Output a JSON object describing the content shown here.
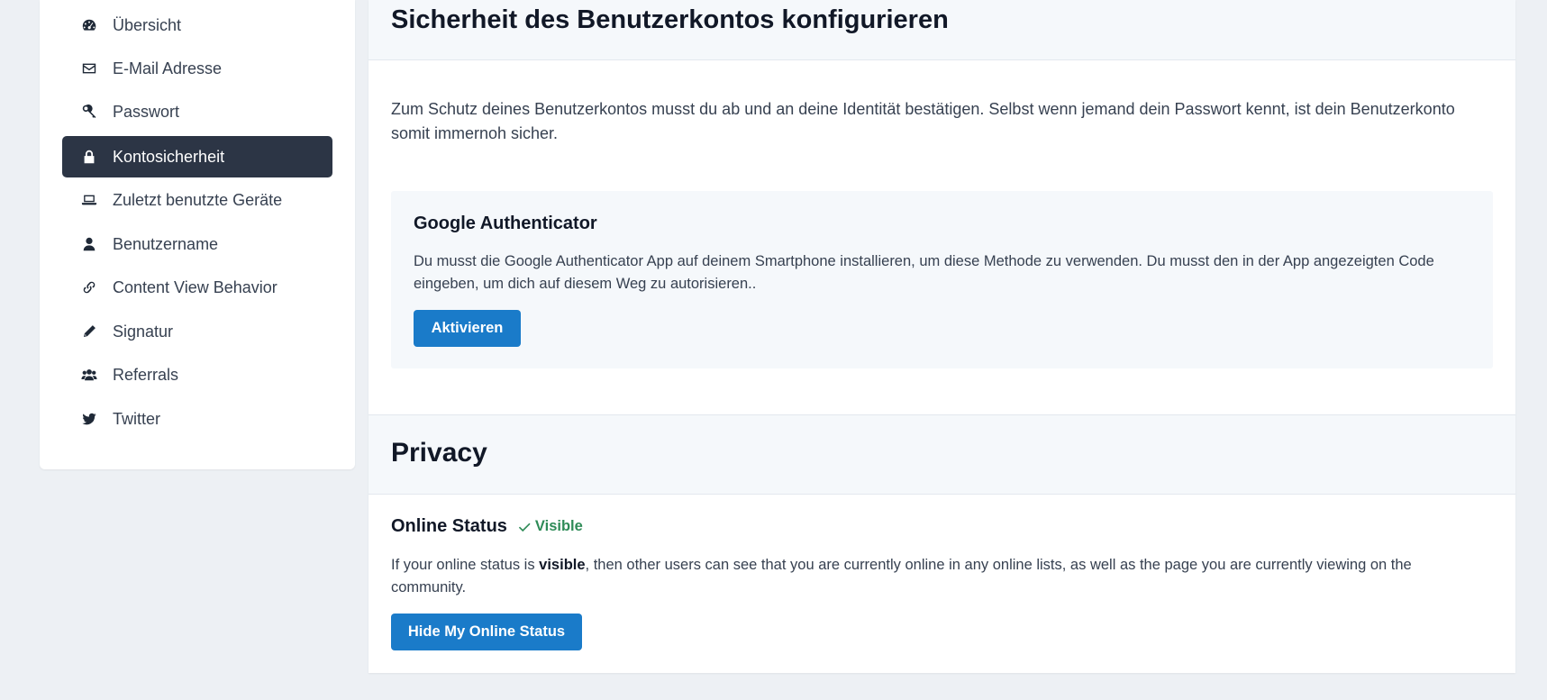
{
  "sidebar": {
    "items": [
      {
        "label": "Übersicht",
        "icon": "dashboard-icon"
      },
      {
        "label": "E-Mail Adresse",
        "icon": "envelope-icon"
      },
      {
        "label": "Passwort",
        "icon": "key-icon"
      },
      {
        "label": "Kontosicherheit",
        "icon": "lock-icon",
        "active": true
      },
      {
        "label": "Zuletzt benutzte Geräte",
        "icon": "laptop-icon"
      },
      {
        "label": "Benutzername",
        "icon": "user-icon"
      },
      {
        "label": "Content View Behavior",
        "icon": "link-icon"
      },
      {
        "label": "Signatur",
        "icon": "pencil-icon"
      },
      {
        "label": "Referrals",
        "icon": "users-icon"
      },
      {
        "label": "Twitter",
        "icon": "twitter-icon"
      }
    ]
  },
  "security": {
    "title": "Sicherheit des Benutzerkontos konfigurieren",
    "intro": "Zum Schutz deines Benutzerkontos musst du ab und an deine Identität bestätigen. Selbst wenn jemand dein Passwort kennt, ist dein Benutzerkonto somit immernoh sicher.",
    "method": {
      "title": "Google Authenticator",
      "description": "Du musst die Google Authenticator App auf deinem Smartphone installieren, um diese Methode zu verwenden. Du musst den in der App angezeigten Code eingeben, um dich auf diesem Weg zu autorisieren..",
      "button_label": "Aktivieren"
    }
  },
  "privacy": {
    "title": "Privacy",
    "online_status": {
      "title": "Online Status",
      "badge": "Visible",
      "desc_before": "If your online status is ",
      "desc_bold": "visible",
      "desc_after": ", then other users can see that you are currently online in any online lists, as well as the page you are currently viewing on the community.",
      "button_label": "Hide My Online Status"
    }
  },
  "colors": {
    "primary_button": "#1a7bc9",
    "active_nav": "#2c3545",
    "visible_badge": "#2e8b57",
    "page_background": "#edf0f4"
  }
}
